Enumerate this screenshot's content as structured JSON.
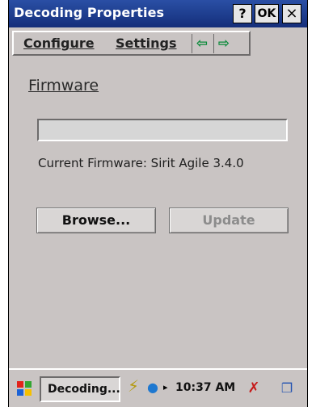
{
  "window": {
    "title": "Decoding Properties",
    "help_label": "?",
    "ok_label": "OK",
    "close_label": "×"
  },
  "menu": {
    "items": [
      {
        "label": "Configure"
      },
      {
        "label": "Settings"
      }
    ],
    "back_icon": "left-arrow-icon",
    "forward_icon": "right-arrow-icon",
    "back_glyph": "⇦",
    "forward_glyph": "⇨"
  },
  "firmware": {
    "heading": "Firmware",
    "progress": 0,
    "current_label": "Current Firmware: Sirit Agile 3.4.0"
  },
  "buttons": {
    "browse_label": "Browse...",
    "update_label": "Update",
    "update_enabled": false
  },
  "taskbar": {
    "task_label": "Decoding...",
    "time": "10:37 AM",
    "icons": [
      "windows-start-icon",
      "power-plug-icon",
      "network-icon",
      "disconnect-icon",
      "switch-window-icon"
    ]
  },
  "colors": {
    "title_bar": "#1c3a8f",
    "background": "#c9c4c3",
    "accent_green": "#0a8a3a"
  }
}
